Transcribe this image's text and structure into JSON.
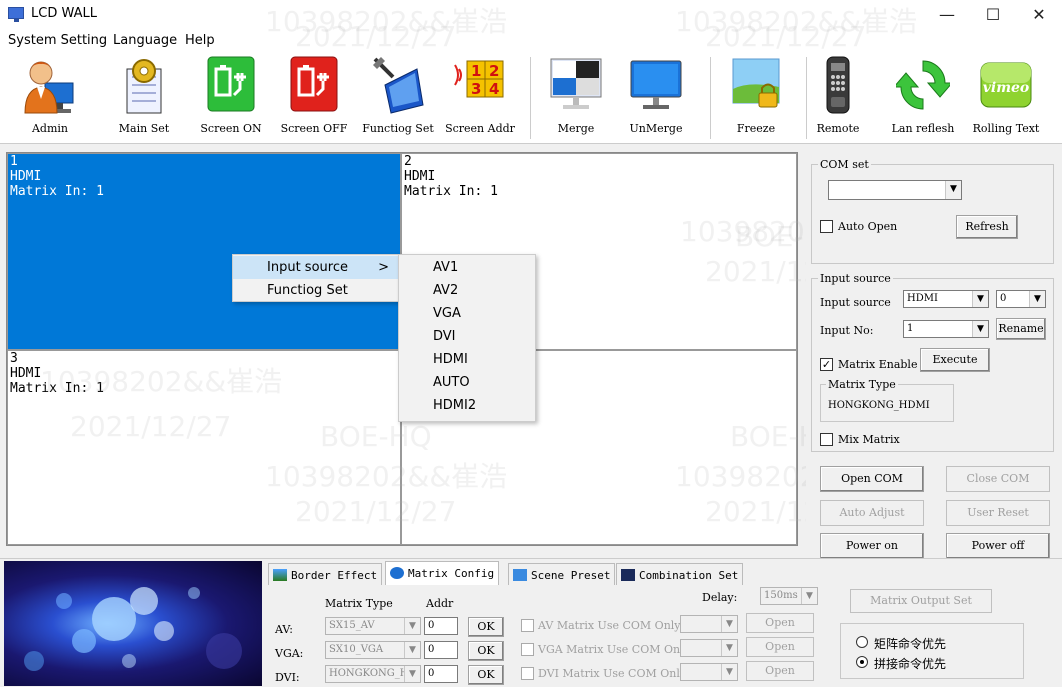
{
  "window": {
    "title": "LCD WALL",
    "minimize": "—",
    "maximize": "☐",
    "close": "✕"
  },
  "menu": [
    "System Setting",
    "Language",
    "Help"
  ],
  "toolbar": [
    {
      "label": "Admin",
      "icon": "admin-icon"
    },
    {
      "label": "Main Set",
      "icon": "main-set-icon"
    },
    {
      "label": "Screen ON",
      "icon": "screen-on-icon"
    },
    {
      "label": "Screen OFF",
      "icon": "screen-off-icon"
    },
    {
      "label": "Functiog Set",
      "icon": "function-set-icon"
    },
    {
      "label": "Screen Addr",
      "icon": "screen-addr-icon"
    },
    {
      "label": "Merge",
      "icon": "merge-icon"
    },
    {
      "label": "UnMerge",
      "icon": "unmerge-icon"
    },
    {
      "label": "Freeze",
      "icon": "freeze-icon"
    },
    {
      "label": "Remote",
      "icon": "remote-icon"
    },
    {
      "label": "Lan reflesh",
      "icon": "lan-refresh-icon"
    },
    {
      "label": "Rolling Text",
      "icon": "rolling-text-icon"
    }
  ],
  "screen_addr_digits": [
    "1",
    "2",
    "3",
    "4"
  ],
  "rolling_text_logo": "vimeo",
  "wall": {
    "cells": [
      {
        "num": "1",
        "source": "HDMI",
        "matrix": "Matrix In: 1"
      },
      {
        "num": "2",
        "source": "HDMI",
        "matrix": "Matrix In: 1"
      },
      {
        "num": "3",
        "source": "HDMI",
        "matrix": "Matrix In: 1"
      },
      {
        "num": "",
        "source": "",
        "matrix": ""
      }
    ]
  },
  "context_menu": {
    "items": [
      "Input source",
      "Functiog Set"
    ],
    "submenu_arrow": ">",
    "submenu": [
      "AV1",
      "AV2",
      "VGA",
      "DVI",
      "HDMI",
      "AUTO",
      "HDMI2"
    ]
  },
  "com_set": {
    "group_label": "COM set",
    "port_value": "",
    "auto_open_label": "Auto Open",
    "refresh_label": "Refresh"
  },
  "input_source": {
    "group_label": "Input source",
    "source_label": "Input source",
    "source_value": "HDMI",
    "source_index": "0",
    "no_label": "Input No:",
    "no_value": "1",
    "rename_label": "Rename",
    "matrix_enable_label": "Matrix Enable",
    "execute_label": "Execute",
    "matrix_type_label": "Matrix Type",
    "matrix_type_value": "HONGKONG_HDMI",
    "mix_matrix_label": "Mix Matrix"
  },
  "com_buttons": {
    "open_com": "Open COM",
    "close_com": "Close COM",
    "auto_adjust": "Auto Adjust",
    "user_reset": "User Reset",
    "power_on": "Power on",
    "power_off": "Power off"
  },
  "tabs": [
    "Border Effect",
    "Matrix Config",
    "Scene Preset",
    "Combination Set"
  ],
  "matrix_config": {
    "col_matrix_type": "Matrix Type",
    "col_addr": "Addr",
    "delay_label": "Delay:",
    "delay_value": "150ms",
    "output_set_label": "Matrix Output Set",
    "rows": [
      {
        "label": "AV:",
        "type": "SX15_AV",
        "addr": "0",
        "ok": "OK",
        "com_label": "AV Matrix Use COM Only",
        "open": "Open"
      },
      {
        "label": "VGA:",
        "type": "SX10_VGA",
        "addr": "0",
        "ok": "OK",
        "com_label": "VGA Matrix Use COM Only",
        "open": "Open"
      },
      {
        "label": "DVI:",
        "type": "HONGKONG_HDMI",
        "addr": "0",
        "ok": "OK",
        "com_label": "DVI Matrix Use COM Only",
        "open": "Open"
      }
    ],
    "priority": [
      "矩阵命令优先",
      "拼接命令优先"
    ]
  },
  "watermarks": [
    "10398202&&崔浩",
    "2021/12/27",
    "BOE-HQ"
  ],
  "colors": {
    "selected": "#0078d7",
    "menu_highlight": "#cce4f7"
  }
}
